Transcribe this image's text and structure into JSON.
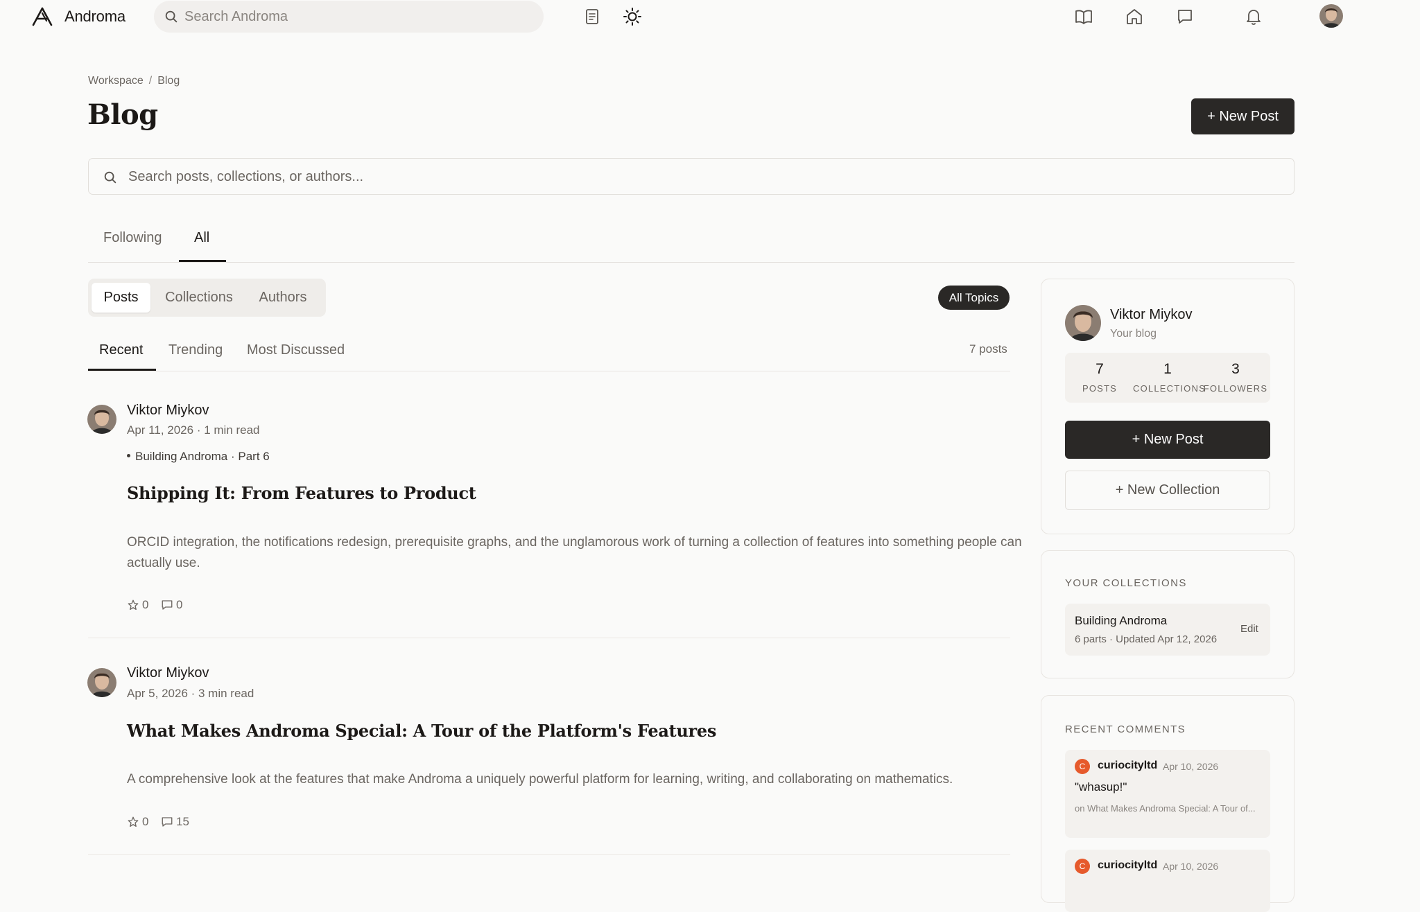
{
  "app": {
    "name": "Androma"
  },
  "nav": {
    "search_placeholder": "Search Androma",
    "icons": [
      "notebook-icon",
      "sun-icon",
      "book-open-icon",
      "home-icon",
      "chat-icon",
      "bell-icon"
    ]
  },
  "breadcrumb": [
    "Workspace",
    "/",
    "Blog"
  ],
  "page": {
    "title": "Blog",
    "new_post_label": "+ New Post"
  },
  "search": {
    "placeholder": "Search posts, collections, or authors..."
  },
  "primary_tabs": [
    {
      "label": "Following",
      "active": false
    },
    {
      "label": "All",
      "active": true
    }
  ],
  "content_types": [
    {
      "label": "Posts",
      "active": true
    },
    {
      "label": "Collections",
      "active": false
    },
    {
      "label": "Authors",
      "active": false
    }
  ],
  "topic_filter": "All Topics",
  "sort_tabs": [
    {
      "label": "Recent",
      "active": true
    },
    {
      "label": "Trending",
      "active": false
    },
    {
      "label": "Most Discussed",
      "active": false
    }
  ],
  "post_count": "7 posts",
  "posts": [
    {
      "author": "Viktor Miykov",
      "meta": "Apr 11, 2026 · 1 min read",
      "series": "Building Androma · Part 6",
      "title": "Shipping It: From Features to Product",
      "excerpt": "ORCID integration, the notifications redesign, prerequisite graphs, and the unglamorous work of turning a collection of features into something people can actually use.",
      "stars": "0",
      "comments": "0"
    },
    {
      "author": "Viktor Miykov",
      "meta": "Apr 5, 2026 · 3 min read",
      "series": "",
      "title": "What Makes Androma Special: A Tour of the Platform's Features",
      "excerpt": "A comprehensive look at the features that make Androma a uniquely powerful platform for learning, writing, and collaborating on mathematics.",
      "stars": "0",
      "comments": "15"
    }
  ],
  "sidebar": {
    "profile": {
      "name": "Viktor Miykov",
      "subtitle": "Your blog",
      "stats": [
        {
          "value": "7",
          "label": "POSTS"
        },
        {
          "value": "1",
          "label": "COLLECTIONS"
        },
        {
          "value": "3",
          "label": "FOLLOWERS"
        }
      ],
      "new_post_label": "+ New Post",
      "new_collection_label": "+ New Collection"
    },
    "collections": {
      "heading": "YOUR COLLECTIONS",
      "items": [
        {
          "name": "Building Androma",
          "meta": "6 parts · Updated Apr 12, 2026",
          "action": "Edit"
        }
      ]
    },
    "recent_comments": {
      "heading": "RECENT COMMENTS",
      "items": [
        {
          "initial": "C",
          "user": "curiocityltd",
          "date": "Apr 10, 2026",
          "text": "\"whasup!\"",
          "on": "on What Makes Androma Special: A Tour of..."
        },
        {
          "initial": "C",
          "user": "curiocityltd",
          "date": "Apr 10, 2026",
          "text": "",
          "on": ""
        }
      ]
    }
  },
  "colors": {
    "primary_button": "#2a2826",
    "background": "#fafaf9",
    "comment_badge": "#e65a2c"
  }
}
